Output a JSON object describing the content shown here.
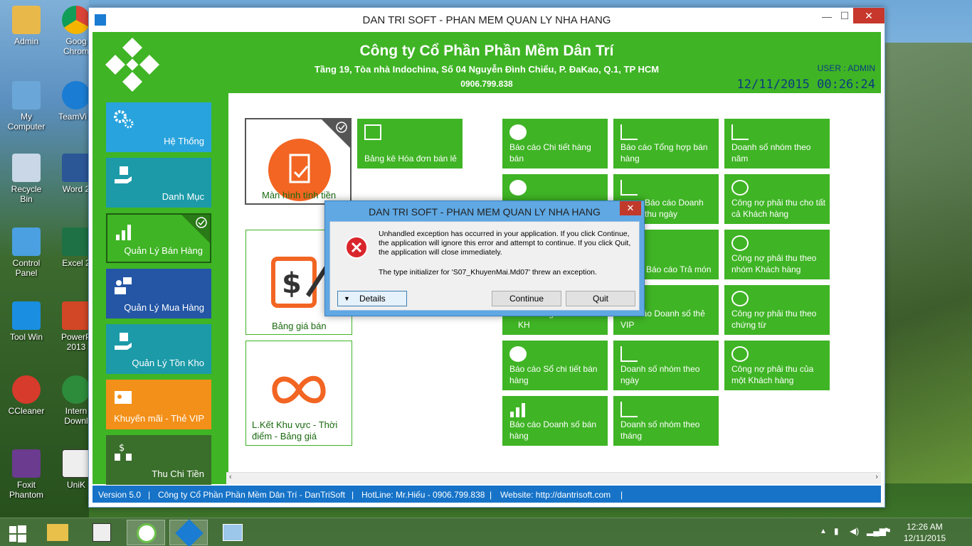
{
  "desktop": {
    "icons": [
      {
        "label": "Admin"
      },
      {
        "label": "Goog Chrom"
      },
      {
        "label": "My Computer"
      },
      {
        "label": "TeamVi 9"
      },
      {
        "label": "Recycle Bin"
      },
      {
        "label": "Word 2"
      },
      {
        "label": "Control Panel"
      },
      {
        "label": "Excel 2"
      },
      {
        "label": "Tool Win"
      },
      {
        "label": "PowerP 2013"
      },
      {
        "label": "CCleaner"
      },
      {
        "label": "Intern Downl"
      },
      {
        "label": "Foxit Phantom"
      },
      {
        "label": "UniK"
      }
    ]
  },
  "window": {
    "title": "DAN TRI SOFT - PHAN MEM QUAN LY NHA HANG",
    "min": "—",
    "max": "☐",
    "close": "✕"
  },
  "header": {
    "company": "Công ty Cổ Phần Phần Mềm Dân Trí",
    "address": "Tầng 19, Tòa nhà Indochina, Số 04 Nguyễn Đình Chiểu, P. ĐaKao, Q.1, TP HCM",
    "phone": "0906.799.838",
    "user": "USER : ADMIN",
    "datetime": "12/11/2015 00:26:24"
  },
  "sidebar": {
    "items": [
      {
        "label": "Hệ Thống",
        "color": "#29a3dd"
      },
      {
        "label": "Danh Mục",
        "color": "#1c9aa8"
      },
      {
        "label": "Quản Lý Bán Hàng",
        "color": "#3fb425"
      },
      {
        "label": "Quản Lý Mua Hàng",
        "color": "#2456a5"
      },
      {
        "label": "Quản Lý Tồn Kho",
        "color": "#1c9aa8"
      },
      {
        "label": "Khuyến mãi - Thẻ VIP",
        "color": "#f39019"
      },
      {
        "label": "Thu Chi Tiền",
        "color": "#3a6e2b"
      }
    ]
  },
  "main": {
    "big_tiles": [
      {
        "label": "Màn hình tính tiền"
      },
      {
        "label": "Bảng giá bán"
      },
      {
        "label": "L.Kết Khu vực - Thời điểm - Bảng giá"
      }
    ],
    "tiles": [
      {
        "label": "Bảng kê Hóa đơn bán lẻ"
      },
      {
        "label": "Báo cáo Chi tiết hàng bán"
      },
      {
        "label": "Báo cáo Tổng hợp bán hàng"
      },
      {
        "label": "Doanh số nhóm theo năm"
      },
      {
        "label": "Báo cáo Doanh thu ngày"
      },
      {
        "label": "Công nợ phải thu cho tất cả Khách hàng"
      },
      {
        "label": "Báo cáo Trả món"
      },
      {
        "label": "Công nợ phải thu theo nhóm Khách hàng"
      },
      {
        "label": "Báo cáo Doanh số bán hàng nhóm theo KH"
      },
      {
        "label": "Báo cáo Doanh số thẻ VIP"
      },
      {
        "label": "Công nợ phải thu theo chứng từ"
      },
      {
        "label": "Báo cáo Sổ chi tiết bán hàng"
      },
      {
        "label": "Doanh số nhóm theo ngày"
      },
      {
        "label": "Công nợ phải thu của một Khách hàng"
      },
      {
        "label": "Báo cáo Doanh số bán hàng"
      },
      {
        "label": "Doanh số nhóm theo tháng"
      }
    ]
  },
  "statusbar": {
    "version": "Version 5.0",
    "company": "Công ty Cổ Phần Phần Mềm Dân Trí - DanTriSoft",
    "hotline": "HotLine: Mr.Hiếu - 0906.799.838",
    "website": "Website: http://dantrisoft.com",
    "sep": "|"
  },
  "dialog": {
    "title": "DAN TRI SOFT - PHAN MEM QUAN LY NHA HANG",
    "message": "Unhandled exception has occurred in your application. If you click Continue, the application will ignore this error and attempt to continue. If you click Quit, the application will close immediately.",
    "detail": "The type initializer for 'S07_KhuyenMai.Md07' threw an exception.",
    "details_label": "Details",
    "continue_label": "Continue",
    "quit_label": "Quit",
    "close": "✕"
  },
  "taskbar": {
    "time": "12:26 AM",
    "date": "12/11/2015"
  },
  "icons": {
    "error": "error-icon",
    "check": "check-icon"
  }
}
